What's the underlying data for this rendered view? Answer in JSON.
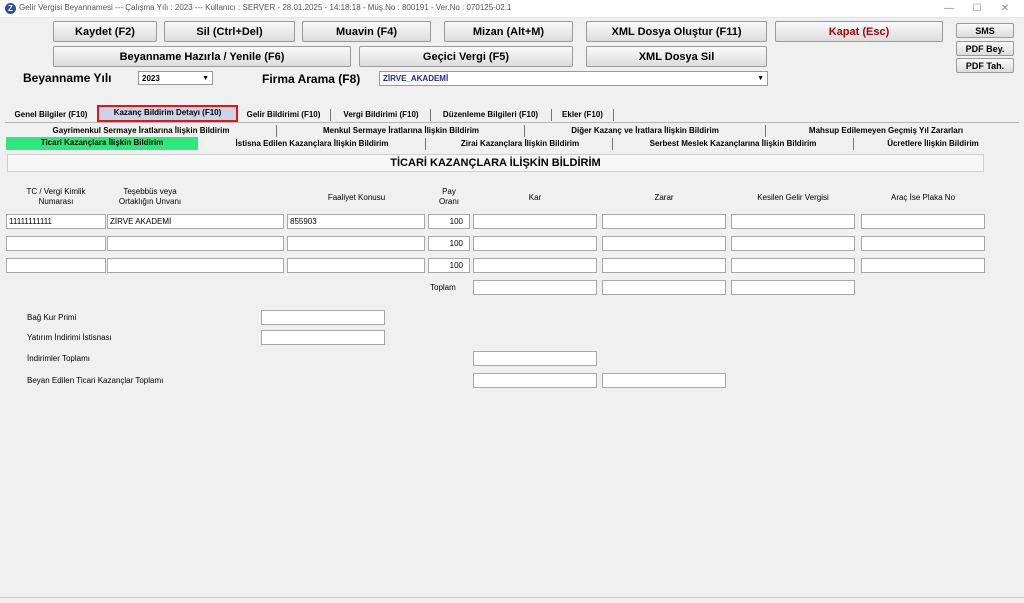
{
  "window": {
    "title": "Gelir Vergisi Beyannamesi  ---  Çalışma Yılı : 2023  ---  Kullanıcı : SERVER - 28.01.2025 - 14:18:18 - Müş.No : 800191 - Ver.No : 070125-02.1"
  },
  "toolbar": {
    "kaydet": "Kaydet (F2)",
    "sil": "Sil (Ctrl+Del)",
    "muavin": "Muavin (F4)",
    "mizan": "Mizan (Alt+M)",
    "xml_olustur": "XML Dosya Oluştur (F11)",
    "kapat": "Kapat (Esc)",
    "beyanname_hazirla": "Beyanname Hazırla / Yenile (F6)",
    "gecici_vergi": "Geçici Vergi (F5)",
    "xml_sil": "XML Dosya Sil",
    "sms": "SMS",
    "pdf_bey": "PDF Bey.",
    "pdf_tah": "PDF Tah."
  },
  "filters": {
    "year_label": "Beyanname Yılı",
    "year_value": "2023",
    "firma_label": "Firma Arama (F8)",
    "firma_value": "ZİRVE_AKADEMİ"
  },
  "tabs": [
    "Genel Bilgiler (F10)",
    "Kazanç Bildirim Detayı (F10)",
    "Gelir Bildirimi (F10)",
    "Vergi Bildirimi (F10)",
    "Düzenleme Bilgileri (F10)",
    "Ekler (F10)"
  ],
  "subtabs_row1": [
    "Gayrimenkul Sermaye İratlarına İlişkin Bildirim",
    "Menkul Sermaye İratlarına İlişkin Bildirim",
    "Diğer Kazanç ve İratlara İlişkin Bildirim",
    "Mahsup Edilemeyen Geçmiş Yıl Zararları"
  ],
  "subtabs_row2": [
    "Ticari Kazançlara İlişkin Bildirim",
    "İstisna Edilen Kazançlara İlişkin Bildirim",
    "Zirai Kazançlara İlişkin Bildirim",
    "Serbest Meslek Kazançlarına İlişkin Bildirim",
    "Ücretlere İlişkin Bildirim"
  ],
  "section_title": "TİCARİ KAZANÇLARA İLİŞKİN BİLDİRİM",
  "columns": {
    "tc_line1": "TC / Vergi Kimlik",
    "tc_line2": "Numarası",
    "tes_line1": "Teşebbüs veya",
    "tes_line2": "Ortaklığın Unvanı",
    "faaliyet": "Faaliyet Konusu",
    "pay_line1": "Pay",
    "pay_line2": "Oranı",
    "kar": "Kar",
    "zarar": "Zarar",
    "kesilen": "Kesilen Gelir Vergisi",
    "arac": "Araç İse Plaka No"
  },
  "rows": [
    {
      "tc": "11111111111",
      "unvan": "ZİRVE AKADEMİ",
      "faaliyet": "855903",
      "pay": "100",
      "kar": "",
      "zarar": "",
      "kesilen": "",
      "plaka": ""
    },
    {
      "tc": "",
      "unvan": "",
      "faaliyet": "",
      "pay": "100",
      "kar": "",
      "zarar": "",
      "kesilen": "",
      "plaka": ""
    },
    {
      "tc": "",
      "unvan": "",
      "faaliyet": "",
      "pay": "100",
      "kar": "",
      "zarar": "",
      "kesilen": "",
      "plaka": ""
    }
  ],
  "toplam_label": "Toplam",
  "summary": {
    "bagkur": "Bağ Kur Primi",
    "yatirim": "Yatırım İndirimi İstisnası",
    "indirimler": "İndirimler Toplamı",
    "beyan": "Beyan Edilen Ticari Kazançlar Toplamı"
  }
}
